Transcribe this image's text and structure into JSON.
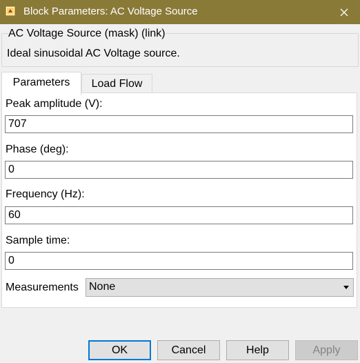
{
  "window": {
    "title": "Block Parameters: AC Voltage Source",
    "close_icon": "close-icon",
    "app_icon": "simulink-block-icon"
  },
  "description_group": {
    "legend": "AC Voltage Source (mask) (link)",
    "description": "Ideal sinusoidal AC Voltage source."
  },
  "tabs": [
    {
      "label": "Parameters",
      "active": true
    },
    {
      "label": "Load Flow",
      "active": false
    }
  ],
  "parameters": {
    "peak_amplitude": {
      "label": "Peak amplitude (V):",
      "value": "707"
    },
    "phase": {
      "label": "Phase (deg):",
      "value": "0"
    },
    "frequency": {
      "label": "Frequency (Hz):",
      "value": "60"
    },
    "sample_time": {
      "label": "Sample time:",
      "value": "0"
    },
    "measurements": {
      "label": "Measurements",
      "selected": "None"
    }
  },
  "buttons": {
    "ok": "OK",
    "cancel": "Cancel",
    "help": "Help",
    "apply": "Apply"
  }
}
